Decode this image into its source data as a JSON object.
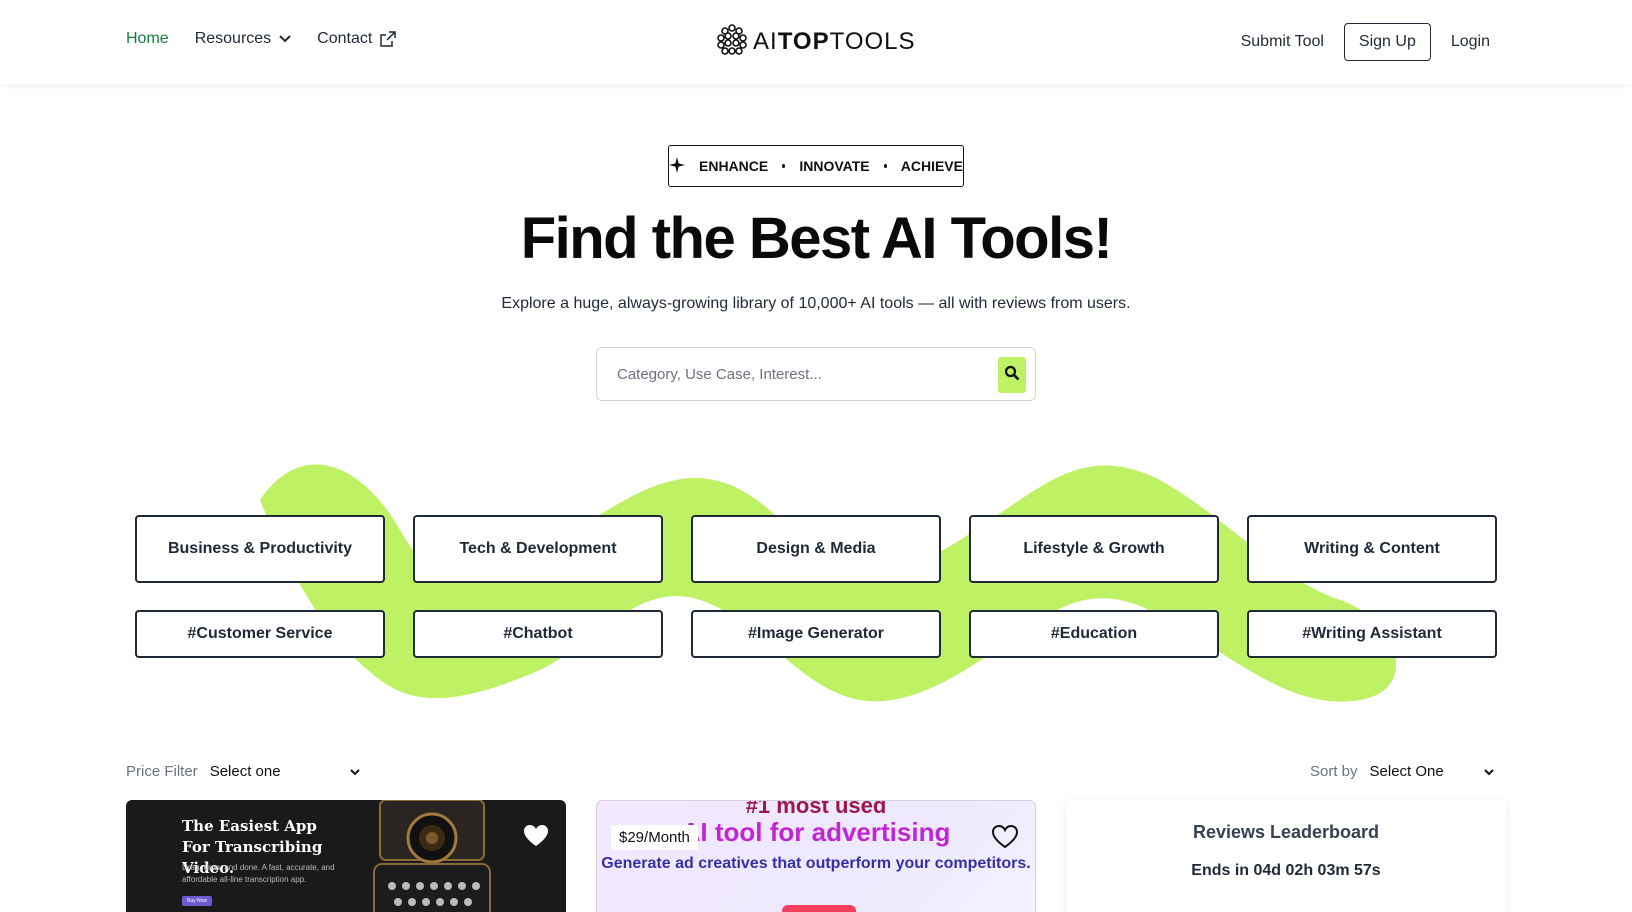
{
  "nav": {
    "home": "Home",
    "resources": "Resources",
    "contact": "Contact",
    "submit_tool": "Submit Tool",
    "sign_up": "Sign Up",
    "login": "Login"
  },
  "logo": {
    "part_thin": "AI",
    "part_bold": "TOP",
    "part_end": "TOOLS"
  },
  "hero": {
    "pill_items": [
      "ENHANCE",
      "INNOVATE",
      "ACHIEVE"
    ],
    "title": "Find the Best AI Tools!",
    "subtitle": "Explore a huge, always-growing library of 10,000+ AI tools — all with reviews from users."
  },
  "search": {
    "placeholder": "Category, Use Case, Interest..."
  },
  "categories": {
    "main": [
      "Business & Productivity",
      "Tech & Development",
      "Design & Media",
      "Lifestyle & Growth",
      "Writing & Content"
    ],
    "tags": [
      "#Customer Service",
      "#Chatbot",
      "#Image Generator",
      "#Education",
      "#Writing Assistant"
    ]
  },
  "filters": {
    "price_label": "Price Filter",
    "price_value": "Select one",
    "sort_label": "Sort by",
    "sort_value": "Select One"
  },
  "cards": {
    "card1": {
      "headline": "The Easiest App For Transcribing Video.",
      "body": "Drag, drop, and done. A fast, accurate, and affordable all-line transcription app.",
      "button": "Buy Now"
    },
    "card2": {
      "price": "$29/Month",
      "ad_top": "#1 most used",
      "ad_main": "AI tool for advertising",
      "ad_sub": "Generate ad creatives that outperform your competitors."
    },
    "card3": {
      "title": "Reviews Leaderboard",
      "ends": "Ends in 04d 02h 03m 57s"
    }
  },
  "colors": {
    "accent_green": "#bef264",
    "active_nav": "#15803d",
    "wave": "#bef264"
  }
}
